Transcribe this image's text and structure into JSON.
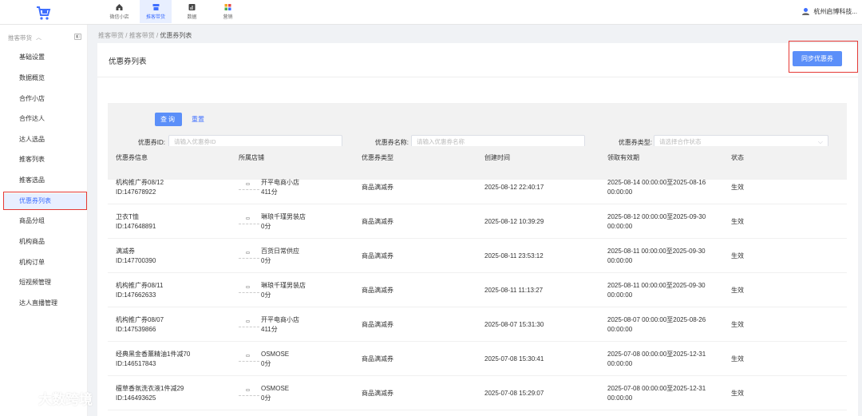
{
  "topnav": [
    {
      "label": "微信小店",
      "icon": "home-icon"
    },
    {
      "label": "推客带货",
      "icon": "shop-icon",
      "active": true
    },
    {
      "label": "数据",
      "icon": "chart-icon"
    },
    {
      "label": "营销",
      "icon": "apps-icon"
    }
  ],
  "user": {
    "name": "杭州启博科技..."
  },
  "sidebar": {
    "group_label": "推客带货",
    "items": [
      {
        "label": "基础设置"
      },
      {
        "label": "数据概览"
      },
      {
        "label": "合作小店"
      },
      {
        "label": "合作达人"
      },
      {
        "label": "达人选品"
      },
      {
        "label": "推客列表"
      },
      {
        "label": "推客选品"
      },
      {
        "label": "优惠券列表",
        "active": true
      },
      {
        "label": "商品分组"
      },
      {
        "label": "机构商品"
      },
      {
        "label": "机构订单"
      },
      {
        "label": "短视频管理"
      },
      {
        "label": "达人直播管理"
      }
    ]
  },
  "breadcrumb": {
    "l1": "推客带货",
    "sep": "/",
    "l2": "推客带货",
    "l3": "优惠券列表"
  },
  "main": {
    "title": "优惠券列表",
    "sync_button": "同步优惠券"
  },
  "filter": {
    "id_label": "优惠券ID:",
    "id_placeholder": "请输入优惠券ID",
    "name_label": "优惠券名称:",
    "name_placeholder": "请输入优惠券名称",
    "type_label": "优惠券类型:",
    "type_placeholder": "请选择合作状态",
    "query_button": "查询",
    "reset_button": "重置"
  },
  "table": {
    "headers": [
      "优惠券信息",
      "所属店铺",
      "优惠券类型",
      "创建时间",
      "领取有效期",
      "状态"
    ],
    "rows": [
      {
        "name": "机构推广券08/12",
        "id": "ID:147678922",
        "shop": "开平电商小店",
        "score": "411分",
        "type": "商品满减券",
        "created": "2025-08-12 22:40:17",
        "valid1": "2025-08-14 00:00:00至2025-08-16",
        "valid2": "00:00:00",
        "status": "生效"
      },
      {
        "name": "卫衣T恤",
        "id": "ID:147648891",
        "shop": "琳琅千瑾男装店",
        "score": "0分",
        "type": "商品满减券",
        "created": "2025-08-12 10:39:29",
        "valid1": "2025-08-12 00:00:00至2025-09-30",
        "valid2": "00:00:00",
        "status": "生效"
      },
      {
        "name": "满减券",
        "id": "ID:147700390",
        "shop": "百货日常供应",
        "score": "0分",
        "type": "商品满减券",
        "created": "2025-08-11 23:53:12",
        "valid1": "2025-08-11 00:00:00至2025-09-30",
        "valid2": "00:00:00",
        "status": "生效"
      },
      {
        "name": "机构推广券08/11",
        "id": "ID:147662633",
        "shop": "琳琅千瑾男装店",
        "score": "0分",
        "type": "商品满减券",
        "created": "2025-08-11 11:13:27",
        "valid1": "2025-08-11 00:00:00至2025-09-30",
        "valid2": "00:00:00",
        "status": "生效"
      },
      {
        "name": "机构推广券08/07",
        "id": "ID:147539866",
        "shop": "开平电商小店",
        "score": "411分",
        "type": "商品满减券",
        "created": "2025-08-07 15:31:30",
        "valid1": "2025-08-07 00:00:00至2025-08-26",
        "valid2": "00:00:00",
        "status": "生效"
      },
      {
        "name": "经典黑金香薰精油1件减70",
        "id": "ID:146517843",
        "shop": "OSMOSE",
        "score": "0分",
        "type": "商品满减券",
        "created": "2025-07-08 15:30:41",
        "valid1": "2025-07-08 00:00:00至2025-12-31",
        "valid2": "00:00:00",
        "status": "生效"
      },
      {
        "name": "檀草香氛洗衣液1件减29",
        "id": "ID:146493625",
        "shop": "OSMOSE",
        "score": "0分",
        "type": "商品满减券",
        "created": "2025-07-08 15:29:07",
        "valid1": "2025-07-08 00:00:00至2025-12-31",
        "valid2": "00:00:00",
        "status": "生效"
      }
    ]
  },
  "watermark": {
    "text": "大数跨境"
  },
  "colors": {
    "accent": "#5b8ff9",
    "active_bg": "#e8efff",
    "highlight_box": "#e53935"
  }
}
